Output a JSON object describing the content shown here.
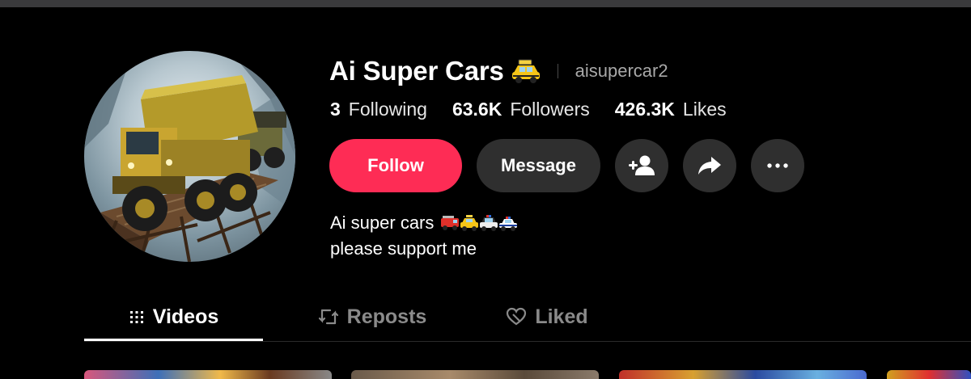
{
  "profile": {
    "display_name": "Ai Super Cars",
    "username": "aisupercar2",
    "name_emoji": "taxi-emoji",
    "avatar": "mining-truck-on-bridge"
  },
  "stats": {
    "following_count": "3",
    "following_label": "Following",
    "followers_count": "63.6K",
    "followers_label": "Followers",
    "likes_count": "426.3K",
    "likes_label": "Likes"
  },
  "actions": {
    "follow_label": "Follow",
    "message_label": "Message",
    "icons": [
      "add-friend-icon",
      "share-icon",
      "more-icon"
    ]
  },
  "bio": {
    "line1": "Ai super cars",
    "line1_emojis": [
      "fire-engine-emoji",
      "taxi-emoji",
      "police-car-emoji",
      "police-car-emoji"
    ],
    "line2": "please support me"
  },
  "tabs": [
    {
      "label": "Videos",
      "icon": "grid-icon",
      "active": true
    },
    {
      "label": "Reposts",
      "icon": "repost-icon",
      "active": false
    },
    {
      "label": "Liked",
      "icon": "heart-lock-icon",
      "active": false
    }
  ],
  "colors": {
    "background": "#000000",
    "follow": "#fe2c55",
    "secondary_button": "#2f2f2f",
    "muted_text": "#8a8a8a"
  }
}
